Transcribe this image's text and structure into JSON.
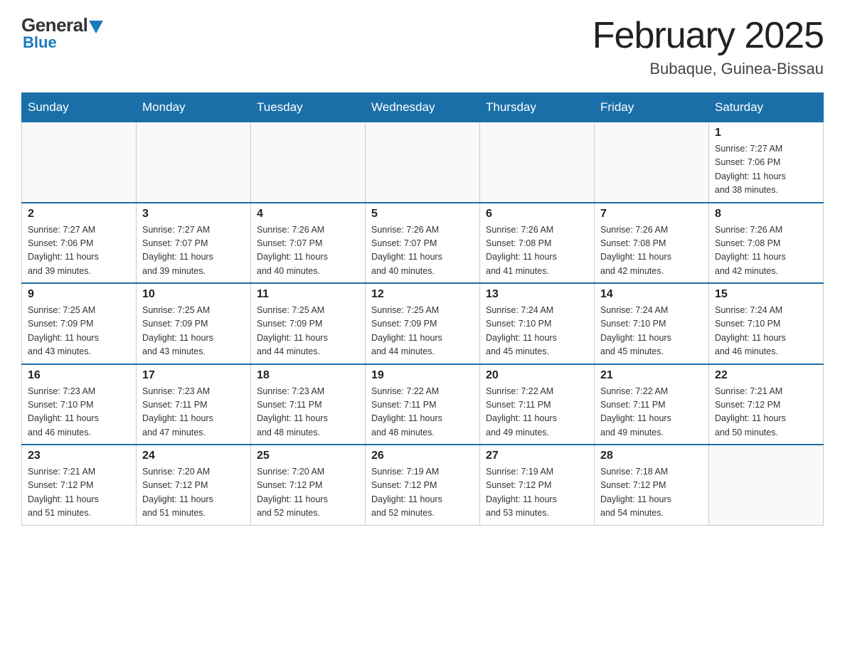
{
  "header": {
    "logo": {
      "general": "General",
      "blue": "Blue"
    },
    "title": "February 2025",
    "location": "Bubaque, Guinea-Bissau"
  },
  "weekdays": [
    "Sunday",
    "Monday",
    "Tuesday",
    "Wednesday",
    "Thursday",
    "Friday",
    "Saturday"
  ],
  "weeks": [
    [
      {
        "day": "",
        "info": ""
      },
      {
        "day": "",
        "info": ""
      },
      {
        "day": "",
        "info": ""
      },
      {
        "day": "",
        "info": ""
      },
      {
        "day": "",
        "info": ""
      },
      {
        "day": "",
        "info": ""
      },
      {
        "day": "1",
        "info": "Sunrise: 7:27 AM\nSunset: 7:06 PM\nDaylight: 11 hours\nand 38 minutes."
      }
    ],
    [
      {
        "day": "2",
        "info": "Sunrise: 7:27 AM\nSunset: 7:06 PM\nDaylight: 11 hours\nand 39 minutes."
      },
      {
        "day": "3",
        "info": "Sunrise: 7:27 AM\nSunset: 7:07 PM\nDaylight: 11 hours\nand 39 minutes."
      },
      {
        "day": "4",
        "info": "Sunrise: 7:26 AM\nSunset: 7:07 PM\nDaylight: 11 hours\nand 40 minutes."
      },
      {
        "day": "5",
        "info": "Sunrise: 7:26 AM\nSunset: 7:07 PM\nDaylight: 11 hours\nand 40 minutes."
      },
      {
        "day": "6",
        "info": "Sunrise: 7:26 AM\nSunset: 7:08 PM\nDaylight: 11 hours\nand 41 minutes."
      },
      {
        "day": "7",
        "info": "Sunrise: 7:26 AM\nSunset: 7:08 PM\nDaylight: 11 hours\nand 42 minutes."
      },
      {
        "day": "8",
        "info": "Sunrise: 7:26 AM\nSunset: 7:08 PM\nDaylight: 11 hours\nand 42 minutes."
      }
    ],
    [
      {
        "day": "9",
        "info": "Sunrise: 7:25 AM\nSunset: 7:09 PM\nDaylight: 11 hours\nand 43 minutes."
      },
      {
        "day": "10",
        "info": "Sunrise: 7:25 AM\nSunset: 7:09 PM\nDaylight: 11 hours\nand 43 minutes."
      },
      {
        "day": "11",
        "info": "Sunrise: 7:25 AM\nSunset: 7:09 PM\nDaylight: 11 hours\nand 44 minutes."
      },
      {
        "day": "12",
        "info": "Sunrise: 7:25 AM\nSunset: 7:09 PM\nDaylight: 11 hours\nand 44 minutes."
      },
      {
        "day": "13",
        "info": "Sunrise: 7:24 AM\nSunset: 7:10 PM\nDaylight: 11 hours\nand 45 minutes."
      },
      {
        "day": "14",
        "info": "Sunrise: 7:24 AM\nSunset: 7:10 PM\nDaylight: 11 hours\nand 45 minutes."
      },
      {
        "day": "15",
        "info": "Sunrise: 7:24 AM\nSunset: 7:10 PM\nDaylight: 11 hours\nand 46 minutes."
      }
    ],
    [
      {
        "day": "16",
        "info": "Sunrise: 7:23 AM\nSunset: 7:10 PM\nDaylight: 11 hours\nand 46 minutes."
      },
      {
        "day": "17",
        "info": "Sunrise: 7:23 AM\nSunset: 7:11 PM\nDaylight: 11 hours\nand 47 minutes."
      },
      {
        "day": "18",
        "info": "Sunrise: 7:23 AM\nSunset: 7:11 PM\nDaylight: 11 hours\nand 48 minutes."
      },
      {
        "day": "19",
        "info": "Sunrise: 7:22 AM\nSunset: 7:11 PM\nDaylight: 11 hours\nand 48 minutes."
      },
      {
        "day": "20",
        "info": "Sunrise: 7:22 AM\nSunset: 7:11 PM\nDaylight: 11 hours\nand 49 minutes."
      },
      {
        "day": "21",
        "info": "Sunrise: 7:22 AM\nSunset: 7:11 PM\nDaylight: 11 hours\nand 49 minutes."
      },
      {
        "day": "22",
        "info": "Sunrise: 7:21 AM\nSunset: 7:12 PM\nDaylight: 11 hours\nand 50 minutes."
      }
    ],
    [
      {
        "day": "23",
        "info": "Sunrise: 7:21 AM\nSunset: 7:12 PM\nDaylight: 11 hours\nand 51 minutes."
      },
      {
        "day": "24",
        "info": "Sunrise: 7:20 AM\nSunset: 7:12 PM\nDaylight: 11 hours\nand 51 minutes."
      },
      {
        "day": "25",
        "info": "Sunrise: 7:20 AM\nSunset: 7:12 PM\nDaylight: 11 hours\nand 52 minutes."
      },
      {
        "day": "26",
        "info": "Sunrise: 7:19 AM\nSunset: 7:12 PM\nDaylight: 11 hours\nand 52 minutes."
      },
      {
        "day": "27",
        "info": "Sunrise: 7:19 AM\nSunset: 7:12 PM\nDaylight: 11 hours\nand 53 minutes."
      },
      {
        "day": "28",
        "info": "Sunrise: 7:18 AM\nSunset: 7:12 PM\nDaylight: 11 hours\nand 54 minutes."
      },
      {
        "day": "",
        "info": ""
      }
    ]
  ]
}
